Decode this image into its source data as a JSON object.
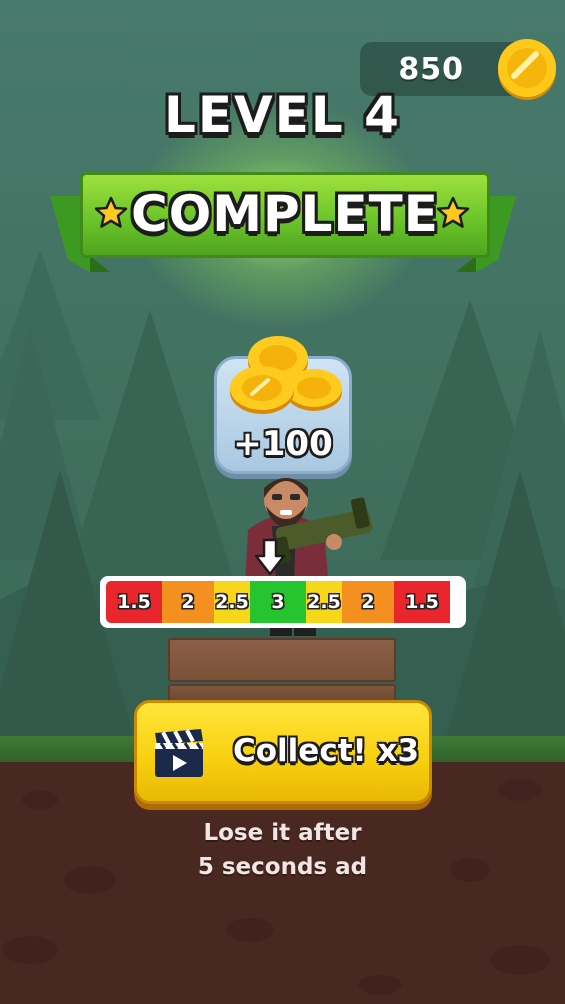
{
  "hud": {
    "coin_count": "850",
    "coin_icon": "gold-coin-icon"
  },
  "title": {
    "level": "LEVEL 4",
    "banner": "COMPLETE",
    "star_icon": "star-icon"
  },
  "reward": {
    "amount": "+100",
    "icon": "coin-stack-icon"
  },
  "multiplier": {
    "pointer_icon": "down-arrow-icon",
    "segments": [
      {
        "label": "1.5",
        "color": "#e8262c"
      },
      {
        "label": "2",
        "color": "#f3901f"
      },
      {
        "label": "2.5",
        "color": "#f7d719"
      },
      {
        "label": "3",
        "color": "#26c52f"
      },
      {
        "label": "2.5",
        "color": "#f7d719"
      },
      {
        "label": "2",
        "color": "#f3901f"
      },
      {
        "label": "1.5",
        "color": "#e8262c"
      }
    ]
  },
  "collect": {
    "label": "Collect! x3",
    "icon": "clapperboard-icon"
  },
  "note": {
    "line1": "Lose it after",
    "line2": "5 seconds ad"
  },
  "colors": {
    "accent_yellow": "#f7cf0e",
    "banner_green": "#6cc52a",
    "background_green": "#41705f",
    "soil_brown": "#4a2822"
  }
}
